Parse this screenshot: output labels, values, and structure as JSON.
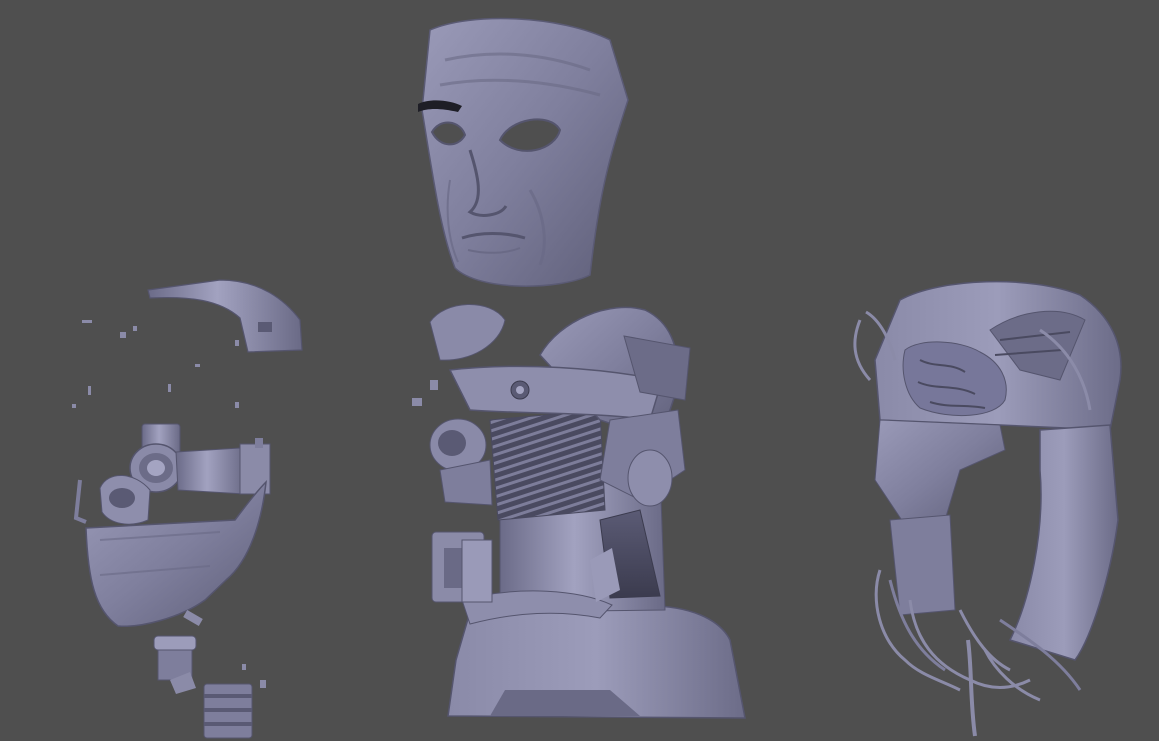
{
  "viewport": {
    "background": "#4f4f4f",
    "material_base": "#7e7e9c",
    "material_light": "#a4a4c2",
    "material_mid": "#8b8ba8",
    "material_dark": "#55556e",
    "material_deep": "#3b3b4e",
    "objects": [
      "face-mask-model",
      "jaw-mechanism-parts-model",
      "torso-endoskeleton-model",
      "cranium-shell-model"
    ]
  }
}
